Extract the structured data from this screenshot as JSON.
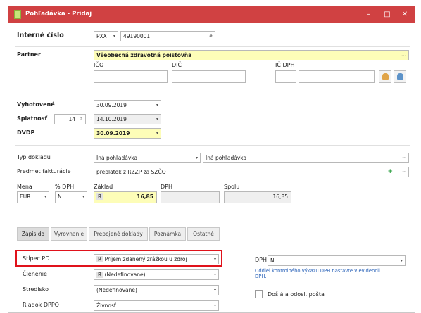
{
  "window": {
    "title": "Pohľadávka - Pridaj",
    "minimize": "–",
    "maximize": "□",
    "close": "✕"
  },
  "header": {
    "internal_number_label": "Interné číslo",
    "series": "PXX",
    "number": "49190001",
    "number_suffix": "#"
  },
  "partner": {
    "label": "Partner",
    "value": "Všeobecná zdravotná poisťovňa",
    "more": "...",
    "ico_label": "IČO",
    "dic_label": "DIČ",
    "icdph_label": "IČ DPH",
    "ico": "",
    "dic": "",
    "icdph_prefix": "",
    "icdph": ""
  },
  "dates": {
    "issued_label": "Vyhotovené",
    "issued": "30.09.2019",
    "due_label": "Splatnosť",
    "due_days": "14",
    "due": "14.10.2019",
    "dvdp_label": "DVDP",
    "dvdp": "30.09.2019"
  },
  "document": {
    "type_label": "Typ dokladu",
    "type": "Iná pohľadávka",
    "type_desc": "Iná pohľadávka",
    "subject_label": "Predmet fakturácie",
    "subject": "preplatok z RZZP za SZČO",
    "ellipsis": "···"
  },
  "amounts": {
    "currency_label": "Mena",
    "currency": "EUR",
    "vat_pct_label": "% DPH",
    "vat_pct": "N",
    "base_label": "Základ",
    "base_prefix": "R",
    "base": "16,85",
    "vat_label": "DPH",
    "vat": "",
    "total_label": "Spolu",
    "total": "16,85"
  },
  "tabs": [
    "Zápis do",
    "Vyrovnanie",
    "Prepojené doklady",
    "Poznámka",
    "Ostatné"
  ],
  "zapis": {
    "column_label": "Stĺpec PD",
    "column_prefix": "R",
    "column_value": "Príjem zdanený zrážkou u zdroj",
    "division_label": "Členenie",
    "division_prefix": "R",
    "division_value": "(Nedefinované)",
    "center_label": "Stredisko",
    "center_value": "(Nedefinované)",
    "row_label": "Riadok DPPO",
    "row_value": "Živnosť",
    "vat_label": "DPH",
    "vat_value": "N",
    "vat_note_line1": "Oddiel kontrolného výkazu DPH nastavte v evidencii",
    "vat_note_line2": "DPH.",
    "mail_label": "Došlá a odosl. pošta"
  }
}
